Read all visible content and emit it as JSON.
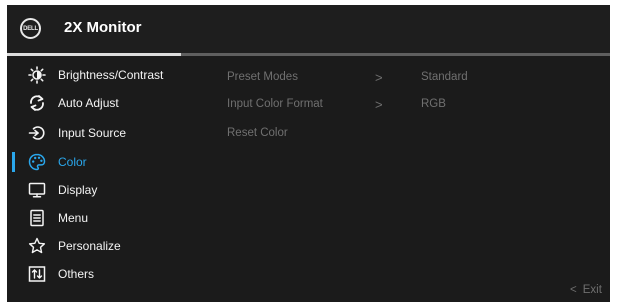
{
  "header": {
    "logo_text": "DELL",
    "title": "2X Monitor"
  },
  "menu": [
    {
      "label": "Brightness/Contrast",
      "icon": "brightness-icon"
    },
    {
      "label": "Auto Adjust",
      "icon": "auto-adjust-icon"
    },
    {
      "label": "Input Source",
      "icon": "input-source-icon"
    },
    {
      "label": "Color",
      "icon": "color-palette-icon",
      "active": true
    },
    {
      "label": "Display",
      "icon": "display-icon"
    },
    {
      "label": "Menu",
      "icon": "menu-icon"
    },
    {
      "label": "Personalize",
      "icon": "star-icon"
    },
    {
      "label": "Others",
      "icon": "others-icon"
    }
  ],
  "submenu": [
    {
      "label": "Preset Modes",
      "arrow": ">",
      "value": "Standard"
    },
    {
      "label": "Input Color Format",
      "arrow": ">",
      "value": "RGB"
    },
    {
      "label": "Reset Color"
    }
  ],
  "footer": {
    "exit_chevron": "<",
    "exit_label": "Exit"
  },
  "colors": {
    "accent": "#2aa7ec",
    "background": "#1b1b1b",
    "text": "#f4f4f4",
    "muted": "#707070"
  }
}
